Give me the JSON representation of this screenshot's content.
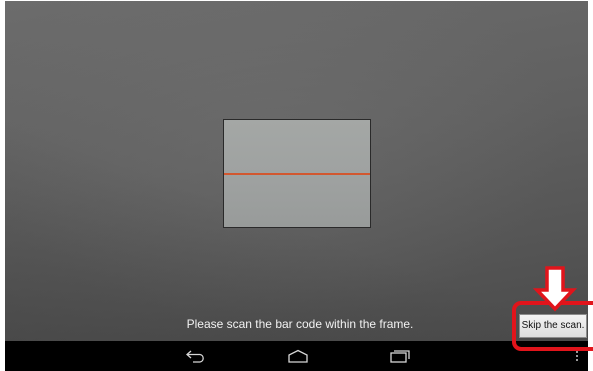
{
  "scanner": {
    "instruction": "Please scan the bar code within the frame.",
    "skip_label": "Skip the scan."
  },
  "nav_bar": {
    "buttons": [
      "back-icon",
      "home-icon",
      "recent-apps-icon",
      "menu-overflow-icon"
    ]
  },
  "colors": {
    "scan_line": "#d2572f",
    "highlight": "#e1141b",
    "nav_bar": "#000000"
  }
}
